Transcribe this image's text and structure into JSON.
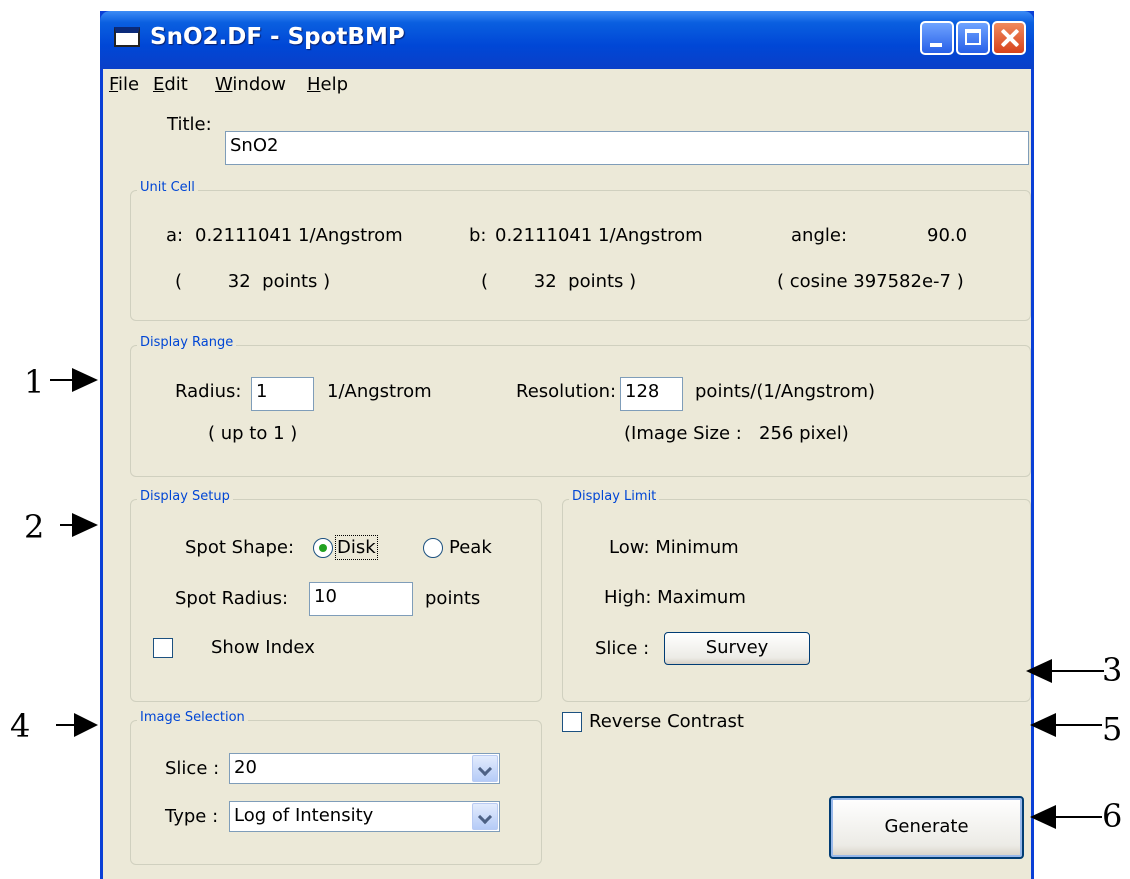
{
  "window": {
    "title": "SnO2.DF - SpotBMP"
  },
  "menu": [
    {
      "key": "F",
      "rest": "ile"
    },
    {
      "key": "E",
      "rest": "dit"
    },
    {
      "key": "W",
      "rest": "indow"
    },
    {
      "key": "H",
      "rest": "elp"
    }
  ],
  "title_field": {
    "label": "Title:",
    "value": "SnO2"
  },
  "unit_cell": {
    "legend": "Unit Cell",
    "a_label": "a:",
    "a_value": "0.2111041 1/Angstrom",
    "b_label": "b:",
    "b_value": "0.2111041 1/Angstrom",
    "angle_label": "angle:",
    "angle_value": "90.0",
    "a_points": "(        32  points )",
    "b_points": "(        32  points )",
    "cosine": "( cosine 397582e-7 )"
  },
  "display_range": {
    "legend": "Display Range",
    "radius_label": "Radius:",
    "radius_value": "1",
    "radius_unit": "1/Angstrom",
    "radius_note": "( up to 1 )",
    "resolution_label": "Resolution:",
    "resolution_value": "128",
    "resolution_unit": "points/(1/Angstrom)",
    "image_size": "(Image Size :   256 pixel)"
  },
  "display_setup": {
    "legend": "Display Setup",
    "shape_label": "Spot Shape:",
    "disk_label": "Disk",
    "peak_label": "Peak",
    "selected_shape": "Disk",
    "radius_label": "Spot Radius:",
    "radius_value": "10",
    "radius_unit": "points",
    "show_index_label": "Show Index",
    "show_index_checked": false
  },
  "display_limit": {
    "legend": "Display Limit",
    "low": "Low: Minimum",
    "high": "High: Maximum",
    "slice_label": "Slice :",
    "survey_button": "Survey"
  },
  "reverse_contrast": {
    "label": "Reverse Contrast",
    "checked": false
  },
  "image_selection": {
    "legend": "Image Selection",
    "slice_label": "Slice :",
    "slice_value": "20",
    "type_label": "Type :",
    "type_value": "Log of Intensity"
  },
  "generate_button": "Generate",
  "annotations": [
    "1",
    "2",
    "3",
    "4",
    "5",
    "6"
  ],
  "colors": {
    "titlebar": "#0047d6",
    "window_bg": "#ece9d8",
    "legend_text": "#0046d5",
    "radio_dot": "#21a121"
  }
}
